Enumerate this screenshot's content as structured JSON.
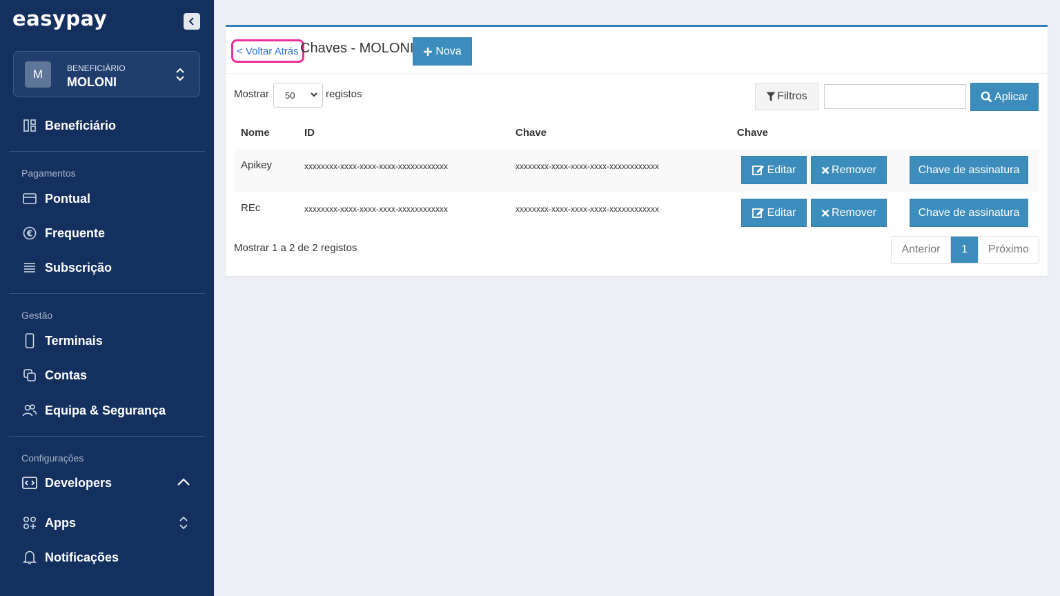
{
  "sidebar": {
    "logo": "easypay",
    "beneficiary": {
      "avatar_letter": "M",
      "label": "BENEFICIÁRIO",
      "name": "MOLONI"
    },
    "top_item": "Beneficiário",
    "sections": [
      {
        "label": "Pagamentos",
        "items": [
          "Pontual",
          "Frequente",
          "Subscrição"
        ]
      },
      {
        "label": "Gestão",
        "items": [
          "Terminais",
          "Contas",
          "Equipa & Segurança"
        ]
      },
      {
        "label": "Configurações",
        "items": [
          "Developers",
          "Apps",
          "Notificações"
        ]
      }
    ]
  },
  "header": {
    "back_label": "< Voltar Atrás",
    "title": "Chaves - MOLONI",
    "new_label": "Nova"
  },
  "controls": {
    "show_label": "Mostrar",
    "page_size": "50",
    "records_label": "registos",
    "filters_label": "Filtros",
    "search_value": "",
    "apply_label": "Aplicar"
  },
  "table": {
    "columns": [
      "Nome",
      "ID",
      "Chave",
      "Chave"
    ],
    "rows": [
      {
        "nome": "Apikey",
        "id": "xxxxxxxx-xxxx-xxxx-xxxx-xxxxxxxxxxxx",
        "chave": "xxxxxxxx-xxxx-xxxx-xxxx-xxxxxxxxxxxx"
      },
      {
        "nome": "REc",
        "id": "xxxxxxxx-xxxx-xxxx-xxxx-xxxxxxxxxxxx",
        "chave": "xxxxxxxx-xxxx-xxxx-xxxx-xxxxxxxxxxxx"
      }
    ],
    "actions": {
      "edit": "Editar",
      "remove": "Remover",
      "signature": "Chave de assinatura"
    }
  },
  "footer": {
    "info": "Mostrar 1 a 2 de 2 registos",
    "prev": "Anterior",
    "current_page": "1",
    "next": "Próximo"
  },
  "colors": {
    "sidebar_bg": "#14305e",
    "primary": "#3c8dbc",
    "highlight": "#ea2f9c"
  }
}
